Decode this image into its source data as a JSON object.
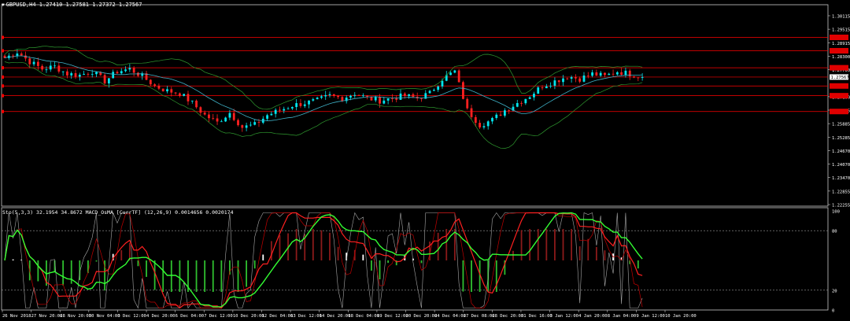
{
  "title": {
    "symbol": "GBPUSD,H4",
    "ohlc": "1.27410 1.27581 1.27372 1.27567"
  },
  "indicator_label": "Sto(5,3,3) 32.1954 34.8672  MACD_OsMA [CurrTF] (12,26,9) 0.0014656 0.0020174",
  "price_axis": [
    "1.30115",
    "1.29515",
    "1.28915",
    "1.28300",
    "1.27700",
    "1.27567",
    "1.27100",
    "1.26485",
    "1.25885",
    "1.25285",
    "1.24670",
    "1.24070",
    "1.23470",
    "1.22855",
    "1.22255"
  ],
  "indicator_axis": [
    "100",
    "80",
    "20",
    "0"
  ],
  "time_axis": [
    "26 Nov 2018",
    "27 Nov 20:00",
    "28 Nov 20:00",
    "30 Nov 04:00",
    "3 Dec 12:00",
    "4 Dec 20:00",
    "6 Dec 04:00",
    "7 Dec 12:00",
    "10 Dec 20:00",
    "12 Dec 04:00",
    "13 Dec 12:00",
    "14 Dec 20:00",
    "18 Dec 04:00",
    "19 Dec 12:00",
    "20 Dec 20:00",
    "24 Dec 04:00",
    "27 Dec 08:00",
    "28 Dec 20:00",
    "31 Dec 16:00",
    "3 Jan 12:00",
    "4 Jan 20:00",
    "8 Jan 04:00",
    "9 Jan 12:00",
    "10 Jan 20:00"
  ],
  "current_price": "1.27567",
  "colors": {
    "background": "#000000",
    "bull": "#00e5ee",
    "bear": "#ff2020",
    "hline": "#ff0000",
    "bands": "#2f9a2f",
    "ma": "#3fb2c8",
    "stoch_main": "#a8a8a8",
    "stoch_signal": "#c00000",
    "osma_up_hi": "#ffffff",
    "osma_down": "#8b1a1a",
    "osma_green": "#2fbf2f",
    "macd_main": "#ff2020",
    "macd_signal": "#33ff33"
  },
  "chart_data": {
    "type": "candlestick",
    "symbol": "GBPUSD",
    "timeframe": "H4",
    "ylim": [
      1.22255,
      1.30415
    ],
    "horizontal_levels": [
      1.292,
      1.2865,
      1.2795,
      1.27567,
      1.272,
      1.268,
      1.2615
    ],
    "close_path": [
      1.2835,
      1.286,
      1.282,
      1.279,
      1.28,
      1.277,
      1.2765,
      1.278,
      1.274,
      1.278,
      1.279,
      1.276,
      1.272,
      1.27,
      1.269,
      1.265,
      1.26,
      1.257,
      1.261,
      1.255,
      1.256,
      1.26,
      1.262,
      1.264,
      1.265,
      1.266,
      1.268,
      1.267,
      1.269,
      1.267,
      1.266,
      1.267,
      1.268,
      1.267,
      1.269,
      1.275,
      1.278,
      1.262,
      1.256,
      1.258,
      1.262,
      1.265,
      1.268,
      1.272,
      1.274,
      1.276,
      1.275,
      1.277,
      1.276,
      1.278,
      1.277,
      1.2757
    ],
    "stochastic": {
      "main": 32.1954,
      "signal": 34.8672,
      "levels": [
        80,
        20
      ]
    },
    "osma": {
      "value": 0.0014656,
      "signal": 0.0020174
    }
  }
}
